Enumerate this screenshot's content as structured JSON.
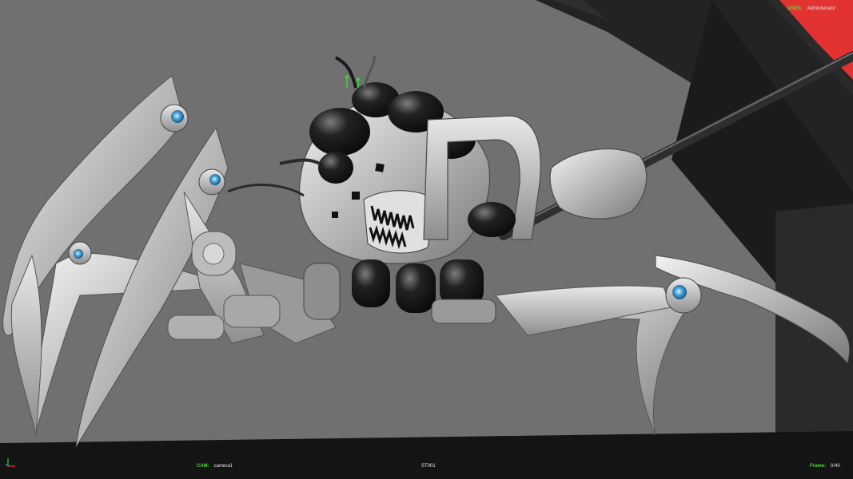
{
  "hud": {
    "user_label": "USER:",
    "user_value": "Administrator",
    "cam_label": "CAM:",
    "cam_value": "camera1",
    "shot": "ST001",
    "frame_label": "Frame:",
    "frame_value": "0/40"
  },
  "colors": {
    "hud_label": "#55d83a",
    "hud_value": "#e8e8e8",
    "warning_stripe": "#e23232",
    "background": "#707070",
    "floor": "#141414"
  },
  "icons": {
    "axis": "axis-gizmo-icon",
    "manipulator": "transform-manipulator-icon"
  }
}
